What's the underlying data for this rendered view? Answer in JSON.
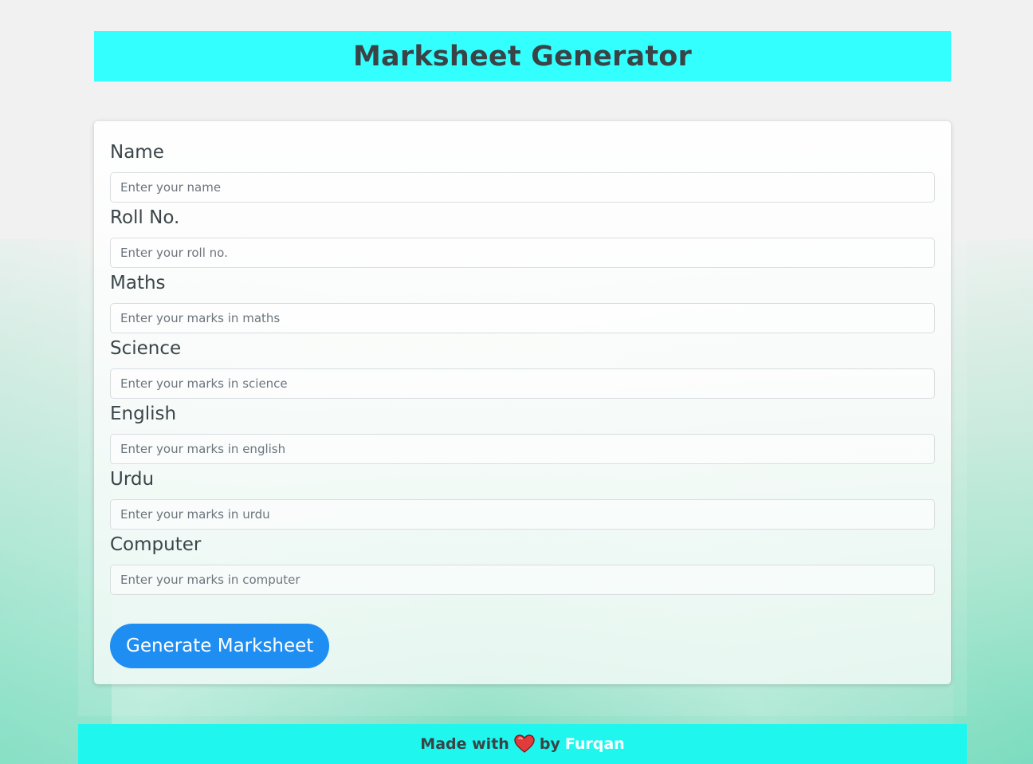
{
  "header": {
    "title": "Marksheet Generator"
  },
  "form": {
    "fields": [
      {
        "label": "Name",
        "placeholder": "Enter your name",
        "value": ""
      },
      {
        "label": "Roll No.",
        "placeholder": "Enter your roll no.",
        "value": ""
      },
      {
        "label": "Maths",
        "placeholder": "Enter your marks in maths",
        "value": ""
      },
      {
        "label": "Science",
        "placeholder": "Enter your marks in science",
        "value": ""
      },
      {
        "label": "English",
        "placeholder": "Enter your marks in english",
        "value": ""
      },
      {
        "label": "Urdu",
        "placeholder": "Enter your marks in urdu",
        "value": ""
      },
      {
        "label": "Computer",
        "placeholder": "Enter your marks in computer",
        "value": ""
      }
    ],
    "submit_label": "Generate Marksheet"
  },
  "footer": {
    "made_with": "Made with",
    "heart_icon": "heart-icon",
    "by": "by",
    "author": "Furqan"
  },
  "colors": {
    "header_bg": "#33ffff",
    "footer_bg": "#1ff7ee",
    "button_bg": "#1e8ef2",
    "heart": "#e23b3b"
  }
}
